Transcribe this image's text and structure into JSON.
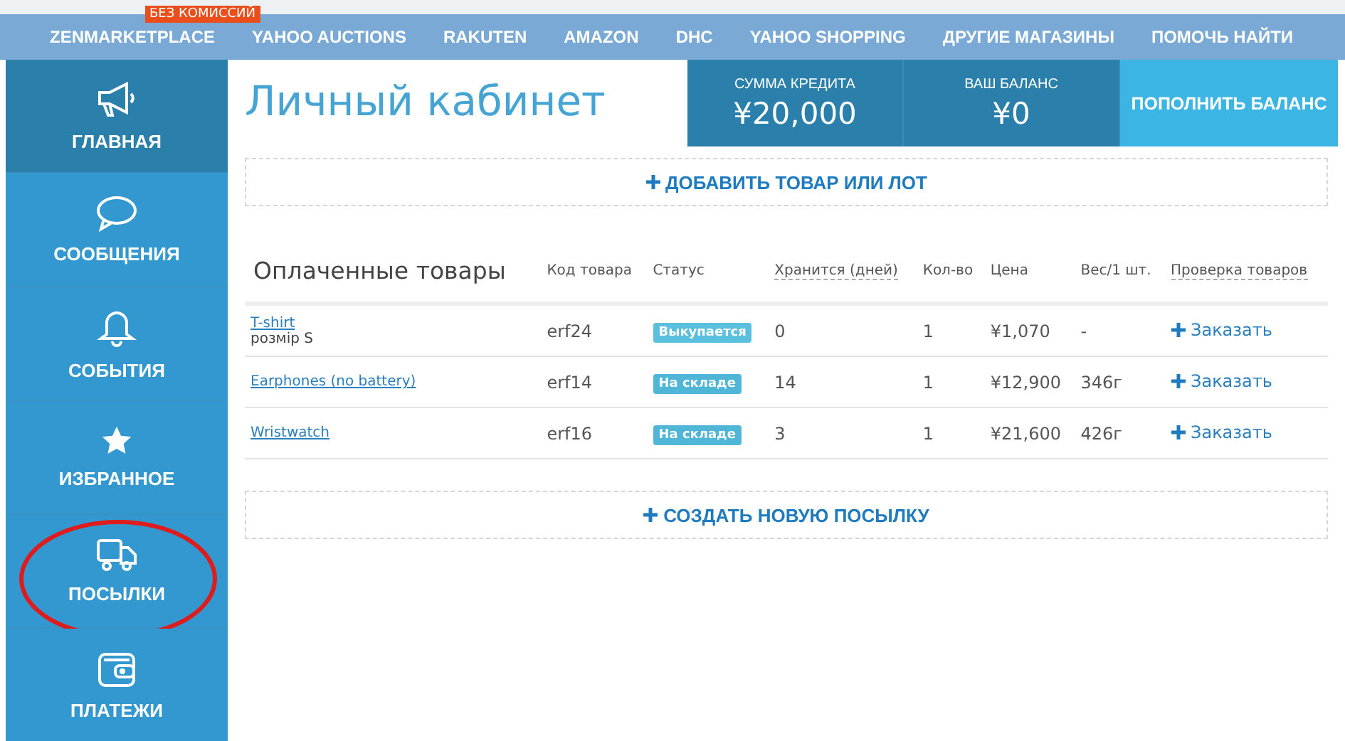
{
  "nav": {
    "badge": "БЕЗ КОМИССИЙ",
    "items": [
      "ZENMARKETPLACE",
      "YAHOO AUCTIONS",
      "RAKUTEN",
      "AMAZON",
      "DHC",
      "YAHOO SHOPPING",
      "ДРУГИЕ МАГАЗИНЫ",
      "ПОМОЧЬ НАЙТИ"
    ]
  },
  "sidebar": {
    "items": [
      {
        "kind": "megaphone",
        "label": "ГЛАВНАЯ",
        "selected": true,
        "circled": false
      },
      {
        "kind": "chat",
        "label": "СООБЩЕНИЯ",
        "selected": false,
        "circled": false
      },
      {
        "kind": "bell",
        "label": "СОБЫТИЯ",
        "selected": false,
        "circled": false
      },
      {
        "kind": "star",
        "label": "ИЗБРАННОЕ",
        "selected": false,
        "circled": false
      },
      {
        "kind": "truck",
        "label": "ПОСЫЛКИ",
        "selected": false,
        "circled": true
      },
      {
        "kind": "wallet",
        "label": "ПЛАТЕЖИ",
        "selected": false,
        "circled": false
      }
    ]
  },
  "page_title": "Личный кабинет",
  "credit": {
    "label": "СУММА КРЕДИТА",
    "value": "¥20,000"
  },
  "balance": {
    "label": "ВАШ БАЛАНС",
    "value": "¥0"
  },
  "topup_button": "ПОПОЛНИТЬ БАЛАНС",
  "add_item_button": "ДОБАВИТЬ ТОВАР ИЛИ ЛОТ",
  "table": {
    "title": "Оплаченные товары",
    "columns": [
      "Код товара",
      "Статус",
      "Хранится (дней)",
      "Кол-во",
      "Цена",
      "Вес/1 шт.",
      "Проверка товаров"
    ],
    "rows": [
      {
        "name": "T-shirt",
        "note": "розмір S",
        "code": "erf24",
        "status": "Выкупается",
        "kind": "buying",
        "days": "0",
        "qty": "1",
        "price": "¥1,070",
        "weight": "-",
        "action": "Заказать"
      },
      {
        "name": "Earphones (no battery)",
        "code": "erf14",
        "status": "На складе",
        "kind": "stock",
        "days": "14",
        "qty": "1",
        "price": "¥12,900",
        "weight": "346г",
        "action": "Заказать"
      },
      {
        "name": "Wristwatch",
        "code": "erf16",
        "status": "На складе",
        "kind": "stock",
        "days": "3",
        "qty": "1",
        "price": "¥21,600",
        "weight": "426г",
        "action": "Заказать"
      }
    ]
  },
  "create_parcel_button": "СОЗДАТЬ НОВУЮ ПОСЫЛКУ"
}
